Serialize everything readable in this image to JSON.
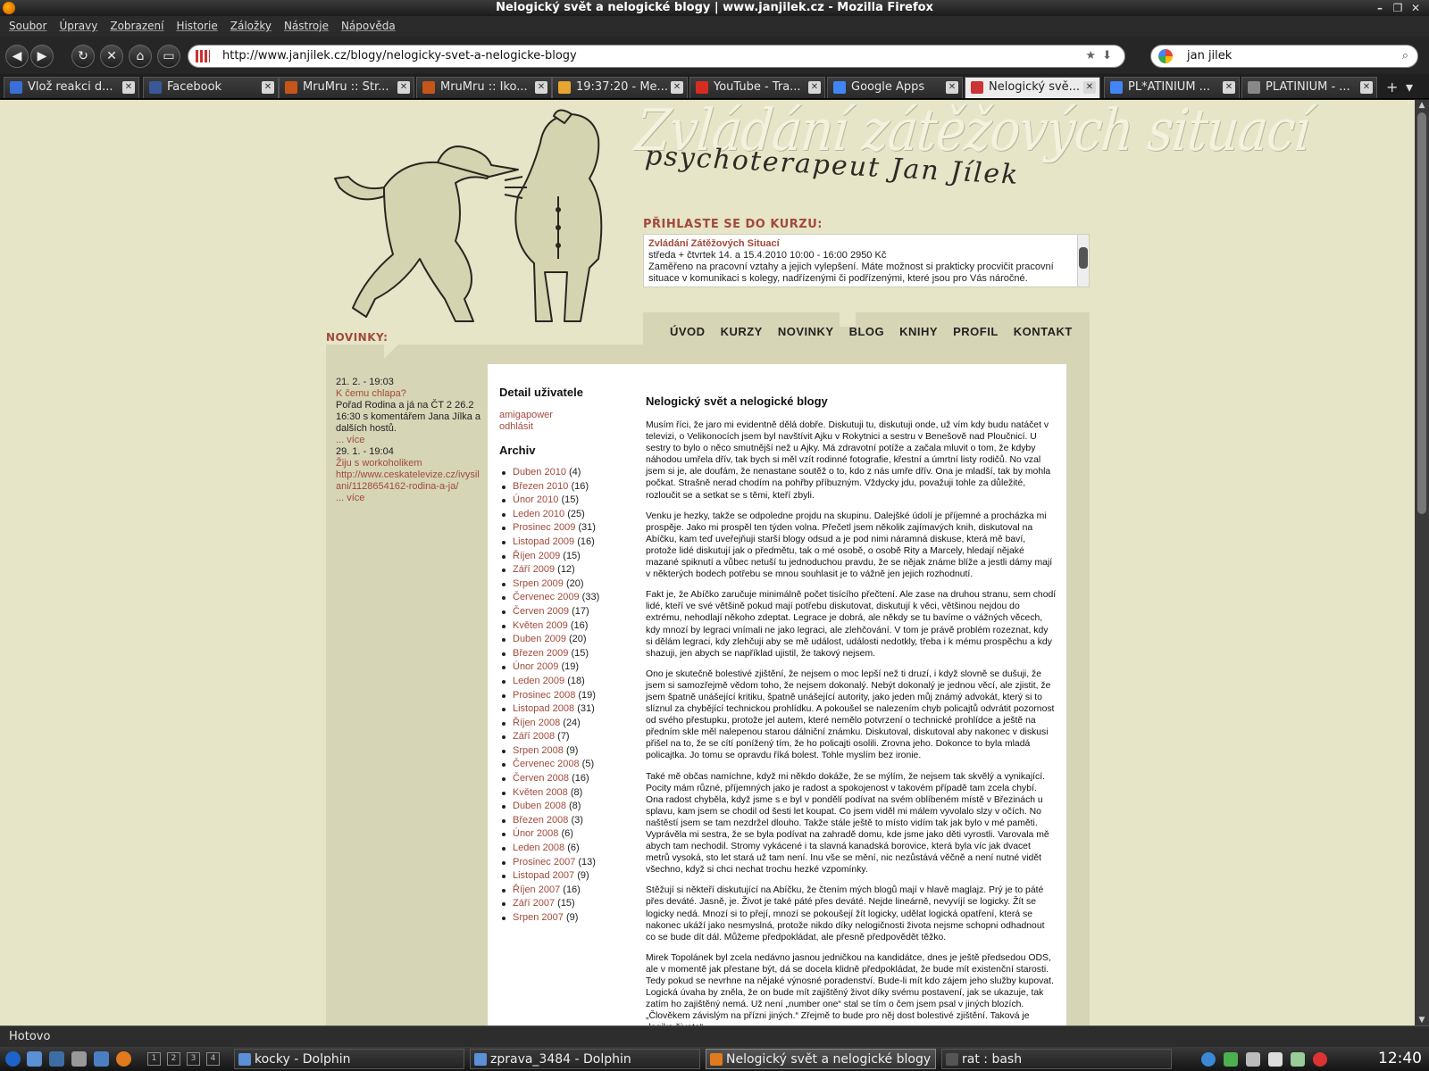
{
  "window": {
    "title": "Nelogický svět a nelogické blogy | www.janjilek.cz - Mozilla Firefox"
  },
  "menu": [
    "Soubor",
    "Úpravy",
    "Zobrazení",
    "Historie",
    "Záložky",
    "Nástroje",
    "Nápověda"
  ],
  "nav": {
    "url": "http://www.janjilek.cz/blogy/nelogicky-svet-a-nelogicke-blogy",
    "search": "jan jilek"
  },
  "tabs": [
    {
      "label": "Vlož reakci d...",
      "color": "#3a6fd8"
    },
    {
      "label": "Facebook",
      "color": "#3b5998"
    },
    {
      "label": "MruMru :: Str...",
      "color": "#c6551a"
    },
    {
      "label": "MruMru :: Iko...",
      "color": "#c6551a"
    },
    {
      "label": "19:37:20 - Me...",
      "color": "#e6a630"
    },
    {
      "label": "YouTube - Tra...",
      "color": "#d62d20"
    },
    {
      "label": "Google Apps",
      "color": "#4285f4"
    },
    {
      "label": "Nelogický svě...",
      "color": "#c33"
    },
    {
      "label": "PL*ATINIUM ...",
      "color": "#4285f4"
    },
    {
      "label": "PLATINIUM - ...",
      "color": "#888"
    }
  ],
  "site": {
    "title": "Zvládání zátěžových situací",
    "subtitle": "psychoterapeut Jan Jílek",
    "course_heading": "PŘIHLASTE SE DO KURZU:",
    "course": {
      "title": "Zvládání Zátěžových Situací",
      "when": "středa + čtvrtek 14. a 15.4.2010 10:00 - 16:00   2950 Kč",
      "desc": "Zaměřeno na pracovní vztahy a jejich vylepšení. Máte možnost si prakticky procvičit pracovní situace v komunikaci s kolegy, nadřízenými či podřízenými, které jsou pro Vás náročné."
    },
    "topnav": [
      "ÚVOD",
      "KURZY",
      "NOVINKY",
      "BLOG",
      "KNIHY",
      "PROFIL",
      "KONTAKT"
    ],
    "news_heading": "NOVINKY:",
    "news": [
      {
        "date": "21. 2. - 19:03",
        "title": "K čemu chlapa?",
        "text": "Pořad Rodina a já na ČT 2 26.2 16:30 s komentářem Jana Jílka a dalších hostů.",
        "link": "",
        "more": "... více"
      },
      {
        "date": "29. 1. - 19:04",
        "title": "Žiju s workoholikem",
        "text": "",
        "link": "http://www.ceskatelevize.cz/ivysilani/1128654162-rodina-a-ja/",
        "more": "... více"
      }
    ]
  },
  "sidebar": {
    "user_heading": "Detail uživatele",
    "user_links": [
      "amigapower",
      "odhlásit"
    ],
    "archive_heading": "Archiv",
    "archive": [
      {
        "m": "Duben 2010",
        "c": "(4)"
      },
      {
        "m": "Březen 2010",
        "c": "(16)"
      },
      {
        "m": "Únor 2010",
        "c": "(15)"
      },
      {
        "m": "Leden 2010",
        "c": "(25)"
      },
      {
        "m": "Prosinec 2009",
        "c": "(31)"
      },
      {
        "m": "Listopad 2009",
        "c": "(16)"
      },
      {
        "m": "Říjen 2009",
        "c": "(15)"
      },
      {
        "m": "Září 2009",
        "c": "(12)"
      },
      {
        "m": "Srpen 2009",
        "c": "(20)"
      },
      {
        "m": "Červenec 2009",
        "c": "(33)"
      },
      {
        "m": "Červen 2009",
        "c": "(17)"
      },
      {
        "m": "Květen 2009",
        "c": "(16)"
      },
      {
        "m": "Duben 2009",
        "c": "(20)"
      },
      {
        "m": "Březen 2009",
        "c": "(15)"
      },
      {
        "m": "Únor 2009",
        "c": "(19)"
      },
      {
        "m": "Leden 2009",
        "c": "(18)"
      },
      {
        "m": "Prosinec 2008",
        "c": "(19)"
      },
      {
        "m": "Listopad 2008",
        "c": "(31)"
      },
      {
        "m": "Říjen 2008",
        "c": "(24)"
      },
      {
        "m": "Září 2008",
        "c": "(7)"
      },
      {
        "m": "Srpen 2008",
        "c": "(9)"
      },
      {
        "m": "Červenec 2008",
        "c": "(5)"
      },
      {
        "m": "Červen 2008",
        "c": "(16)"
      },
      {
        "m": "Květen 2008",
        "c": "(8)"
      },
      {
        "m": "Duben 2008",
        "c": "(8)"
      },
      {
        "m": "Březen 2008",
        "c": "(3)"
      },
      {
        "m": "Únor 2008",
        "c": "(6)"
      },
      {
        "m": "Leden 2008",
        "c": "(6)"
      },
      {
        "m": "Prosinec 2007",
        "c": "(13)"
      },
      {
        "m": "Listopad 2007",
        "c": "(9)"
      },
      {
        "m": "Říjen 2007",
        "c": "(16)"
      },
      {
        "m": "Září 2007",
        "c": "(15)"
      },
      {
        "m": "Srpen 2007",
        "c": "(9)"
      }
    ]
  },
  "article": {
    "title": "Nelogický svět a nelogické blogy",
    "paragraphs": [
      "Musím říci, že jaro mi evidentně dělá dobře. Diskutuji tu, diskutuji onde, už vím kdy budu natáčet v televizi, o Velikonocích jsem byl navštívit Ajku v Rokytnici a sestru v Benešově nad Ploučnicí. U sestry to bylo o něco smutnější než u Ajky. Má zdravotní potíže a začala mluvit o tom, že kdyby náhodou umřela dřív, tak bych si měl vzít rodinné fotografie, křestní a úmrtní listy rodičů. No vzal jsem si je, ale doufám, že nenastane soutěž o to, kdo z nás umře dřív. Ona je mladší, tak by mohla počkat. Strašně nerad chodím na pohřby příbuzným. Vždycky jdu, považuji tohle za důležité, rozloučit se a setkat se s těmi, kteří zbyli.",
      "Venku je hezky, takže se odpoledne projdu na skupinu. Dalejšké údolí je příjemné a procházka mi prospěje. Jako mi prospěl ten týden volna. Přečetl jsem několik zajímavých knih, diskutoval na Abíčku, kam teď uveřejňuji starší blogy odsud a je pod nimi náramná diskuse, která mě baví, protože lidé diskutují jak o předmětu, tak o mé osobě, o osobě Rity a Marcely, hledají nějaké mazané spiknutí a vůbec netuší tu jednoduchou pravdu, že se nějak známe blíže a jestli dámy mají v některých bodech potřebu se mnou souhlasit je to vážně jen jejich rozhodnutí.",
      "Fakt je, že Abíčko zaručuje minimálně počet tisícího přečtení. Ale zase na druhou stranu, sem chodí lidé, kteří ve své většině pokud mají potřebu diskutovat, diskutují k věci, většinou nejdou do extrému, nehodlají někoho zdeptat. Legrace je dobrá, ale někdy se tu bavíme o vážných věcech, kdy mnozí by legraci vnímali ne jako legraci, ale zlehčování. V tom je právě problém rozeznat, kdy si dělám legraci, kdy zlehčuji aby se mě událost, události nedotkly, třeba i k mému prospěchu a kdy shazuji, jen abych se například ujistil, že takový nejsem.",
      "Ono je skutečně bolestivé zjištění, že nejsem o moc lepší než ti druzí, i když slovně se dušuji, že jsem si samozřejmě vědom toho, že nejsem dokonalý. Nebýt dokonalý je jednou věcí, ale zjistit, že jsem špatně unášející kritiku, špatně unášející autority, jako jeden můj známý advokát, který si to slíznul za chybějící technickou prohlídku. A pokoušel se nalezením chyb policajtů odvrátit pozornost od svého přestupku, protože jel autem, které nemělo potvrzení o technické prohlídce a ještě na předním skle měl nalepenou starou dálniční známku. Diskutoval, diskutoval aby nakonec v diskusi přišel na to, že se cítí ponížený tím, že ho policajti osolili. Zrovna jeho. Dokonce to byla mladá policajtka. Jo tomu se opravdu říká bolest. Tohle myslím bez ironie.",
      "Také mě občas namíchne, když mi někdo dokáže, že se mýlím, že nejsem tak skvělý a vynikající. Pocity mám různé, příjemných jako je radost a spokojenost v takovém případě tam zcela chybí. Ona radost chyběla, když jsme s e byl v pondělí podívat na svém oblíbeném místě v Březinách u splavu, kam jsem se chodil od šesti let koupat. Co jsem viděl mi málem vyvolalo slzy v očích. No naštěstí jsem se tam nezdržel dlouho. Takže stále ještě to místo vidím tak jak bylo v mé paměti. Vyprávěla mi sestra, že se byla podívat na zahradě domu, kde jsme jako děti vyrostli. Varovala mě abych tam nechodil. Stromy vykácené i ta slavná kanadská borovice, která byla víc jak dvacet metrů vysoká, sto let stará už tam není. Inu vše se mění, nic nezůstává věčně a není nutné vidět všechno, když si chci nechat trochu hezké vzpomínky.",
      "Stěžují si někteří diskutující na Abíčku, že čtením mých blogů mají v hlavě maglajz. Prý je to páté přes deváté. Jasně, je. Život je také páté přes deváté. Nejde lineárně, nevyvíjí se logicky. Žít se logicky nedá. Mnozí si to přejí, mnozí se pokoušejí žít logicky, udělat logická opatření, která se nakonec ukáží jako nesmyslná, protože nikdo díky nelogičnosti života nejsme schopni odhadnout co se bude dít dál. Můžeme předpokládat, ale přesně předpovědět těžko.",
      "Mirek Topolánek byl zcela nedávno jasnou jedničkou na kandidátce, dnes je ještě předsedou ODS, ale v momentě jak přestane být, dá se docela klidně předpokládat, že bude mít existenční starosti. Tedy pokud se nevrhne na nějaké výnosné poradenství. Bude-li mít kdo zájem jeho služby kupovat. Logická úvaha by zněla, že on bude mít zajištěný život díky svému postavení, jak se ukazuje, tak zatím ho zajištěný nemá. Už není „number one“ stal se tím o čem jsem psal v jiných blozích. „Člověkem závislým na přízni jiných.“ Zřejmě to bude pro něj dost bolestivé zjištění. Taková je „logika života“."
    ]
  },
  "status": "Hotovo",
  "taskbar": {
    "tasks": [
      {
        "label": "kocky - Dolphin",
        "color": "#5b8fd6"
      },
      {
        "label": "zprava_3484 - Dolphin",
        "color": "#5b8fd6"
      },
      {
        "label": "Nelogický svět a nelogické blogy | ww",
        "color": "#e07a1f"
      },
      {
        "label": "rat : bash",
        "color": "#555"
      }
    ],
    "desktops": [
      "1",
      "2",
      "3",
      "4"
    ],
    "clock": "12:40"
  }
}
